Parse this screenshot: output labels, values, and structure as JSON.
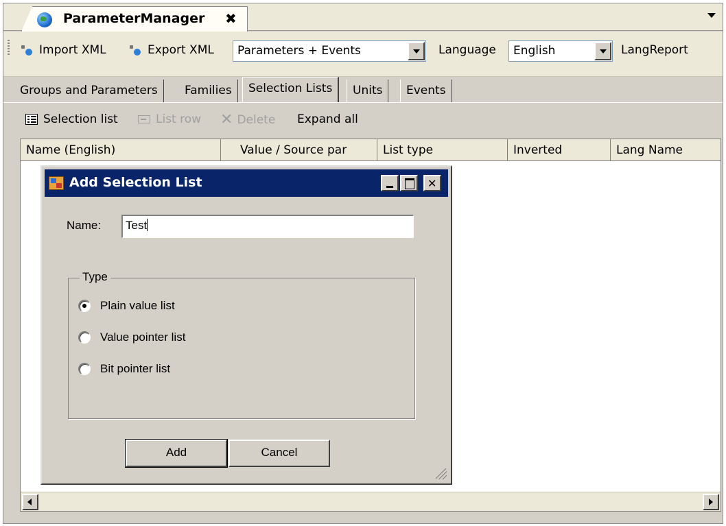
{
  "document_tab": {
    "title": "ParameterManager",
    "close": "x"
  },
  "toolbar": {
    "import_label": "Import XML",
    "export_label": "Export XML",
    "view_combo_value": "Parameters + Events",
    "language_label": "Language",
    "language_value": "English",
    "langreport_label": "LangReport"
  },
  "tabs": [
    {
      "label": "Groups and Parameters"
    },
    {
      "label": "Families"
    },
    {
      "label": "Selection Lists",
      "active": true
    },
    {
      "label": "Units"
    },
    {
      "label": "Events"
    }
  ],
  "sub_toolbar": {
    "selection_list": "Selection list",
    "list_row": "List row",
    "delete": "Delete",
    "expand_all": "Expand all"
  },
  "grid": {
    "columns": [
      "Name (English)",
      "Value / Source par",
      "List type",
      "Inverted",
      "Lang Name"
    ]
  },
  "dialog": {
    "title": "Add Selection List",
    "name_label": "Name:",
    "name_value": "Test",
    "type_group_label": "Type",
    "options": [
      {
        "label": "Plain value list",
        "checked": true
      },
      {
        "label": "Value pointer list",
        "checked": false
      },
      {
        "label": "Bit pointer list",
        "checked": false
      }
    ],
    "add_button": "Add",
    "cancel_button": "Cancel"
  },
  "colors": {
    "titlebar": "#0a246a",
    "face": "#d4d0c8",
    "strip": "#ece9d8"
  }
}
